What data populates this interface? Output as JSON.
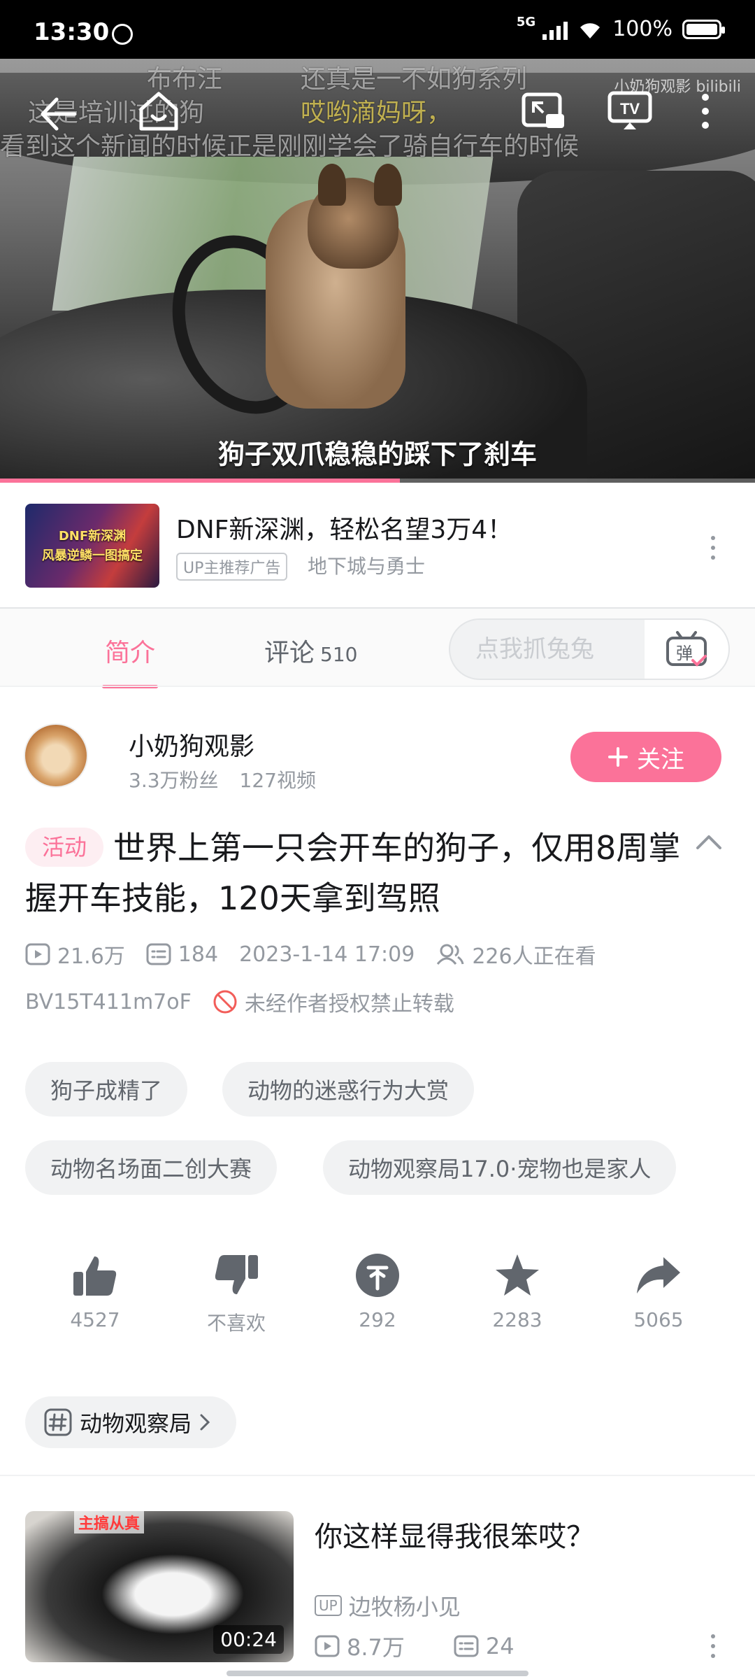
{
  "status_bar": {
    "time": "13:30",
    "network": "5G",
    "battery": "100%"
  },
  "video": {
    "danmaku": [
      "布布汪",
      "还真是一不如狗系列",
      "小奶狗观影",
      "这是培训过的狗",
      "哎哟滴妈呀，",
      "看到这个新闻的时候正是刚刚学会了骑自行车的时候"
    ],
    "watermark": "小奶狗观影 bilibili",
    "subtitle": "狗子双爪稳稳的踩下了刹车",
    "progress": 0.53,
    "icons": [
      "back-icon",
      "home-icon",
      "cast-screen-icon",
      "tv-icon",
      "more-icon"
    ]
  },
  "ad": {
    "thumb_text_1": "DNF新深渊",
    "thumb_text_2": "风暴逆鳞一图搞定",
    "title": "DNF新深渊，轻松名望3万4！",
    "tag": "UP主推荐广告",
    "source": "地下城与勇士"
  },
  "tabs": {
    "intro": "简介",
    "comments": "评论",
    "comments_count": "510",
    "danmaku_placeholder": "点我抓兔兔",
    "danmaku_toggle": "弹"
  },
  "uploader": {
    "name": "小奶狗观影",
    "fans": "3.3万粉丝",
    "videos": "127视频",
    "follow_label": "关注"
  },
  "video_info": {
    "badge": "活动",
    "title": "世界上第一只会开车的狗子，仅用8周掌握开车技能，120天拿到驾照",
    "views": "21.6万",
    "danmaku_count": "184",
    "date": "2023-1-14 17:09",
    "watching": "226人正在看",
    "bvid": "BV15T411m7oF",
    "copyright": "未经作者授权禁止转载"
  },
  "tags": [
    "狗子成精了",
    "动物的迷惑行为大赏",
    "动物名场面二创大赛",
    "动物观察局17.0·宠物也是家人"
  ],
  "actions": {
    "like": "4527",
    "dislike": "不喜欢",
    "coin": "292",
    "favorite": "2283",
    "share": "5065"
  },
  "topic": "动物观察局",
  "related": {
    "title": "你这样显得我很笨哎？",
    "thumb_label": "主搞从真",
    "duration": "00:24",
    "up_tag": "UP",
    "up_name": "边牧杨小见",
    "views": "8.7万",
    "danmaku": "24"
  },
  "colors": {
    "accent": "#fb7299",
    "text": "#18191c",
    "muted": "#9499a0"
  }
}
